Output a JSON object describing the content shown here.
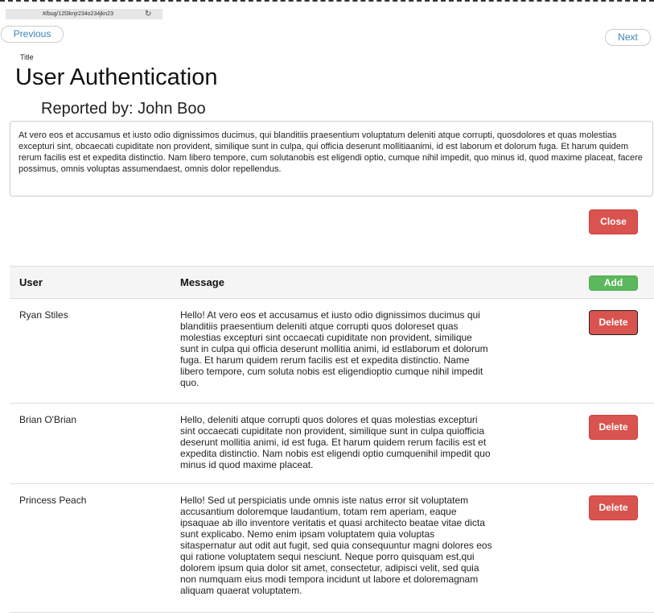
{
  "browser": {
    "url": "#/bug/12l3knjr234o234jkn23",
    "reload_icon": "reload-icon"
  },
  "nav": {
    "previous_label": "Previous",
    "next_label": "Next"
  },
  "bug": {
    "field_label": "Title",
    "title": "User Authentication",
    "reported_by": "Reported by: John Boo",
    "description": "At vero eos et accusamus et iusto odio dignissimos ducimus, qui blanditiis praesentium voluptatum deleniti atque corrupti, quosdolores et quas molestias excepturi sint, obcaecati cupiditate non provident, similique sunt in culpa, qui officia deserunt mollitiaanimi, id est laborum et dolorum fuga. Et harum quidem rerum facilis est et expedita distinctio. Nam libero tempore, cum solutanobis est eligendi optio, cumque nihil impedit, quo minus id, quod maxime placeat, facere possimus, omnis voluptas assumendaest, omnis dolor repellendus.",
    "close_label": "Close"
  },
  "comments": {
    "headers": {
      "user": "User",
      "message": "Message",
      "add_label": "Add"
    },
    "delete_label": "Delete",
    "rows": [
      {
        "user": "Ryan Stiles",
        "message": "Hello! At vero eos et accusamus et iusto odio dignissimos ducimus qui blanditiis praesentium deleniti atque corrupti quos doloreset quas molestias excepturi sint occaecati cupiditate non provident, similique sunt in culpa qui officia deserunt mollitia animi, id estlaborum et dolorum fuga. Et harum quidem rerum facilis est et expedita distinctio. Name libero tempore, cum soluta nobis est eligendioptio cumque nihil impedit quo."
      },
      {
        "user": "Brian O'Brian",
        "message": "Hello, deleniti atque corrupti quos dolores et quas molestias excepturi sint occaecati cupiditate non provident, similique sunt in culpa quiofficia deserunt mollitia animi, id est fuga. Et harum quidem rerum facilis est et expedita distinctio. Nam nobis est eligendi optio cumquenihil impedit quo minus id quod maxime placeat."
      },
      {
        "user": "Princess Peach",
        "message": "Hello! Sed ut perspiciatis unde omnis iste natus error sit voluptatem accusantium doloremque laudantium, totam rem aperiam, eaque ipsaquae ab illo inventore veritatis et quasi architecto beatae vitae dicta sunt explicabo. Nemo enim ipsam voluptatem quia voluptas sitaspernatur aut odit aut fugit, sed quia consequuntur magni dolores eos qui ratione voluptatem sequi nesciunt. Neque porro quisquam est,qui dolorem ipsum quia dolor sit amet, consectetur, adipisci velit, sed quia non numquam eius modi tempora incidunt ut labore et doloremagnam aliquam quaerat voluptatem."
      }
    ]
  }
}
